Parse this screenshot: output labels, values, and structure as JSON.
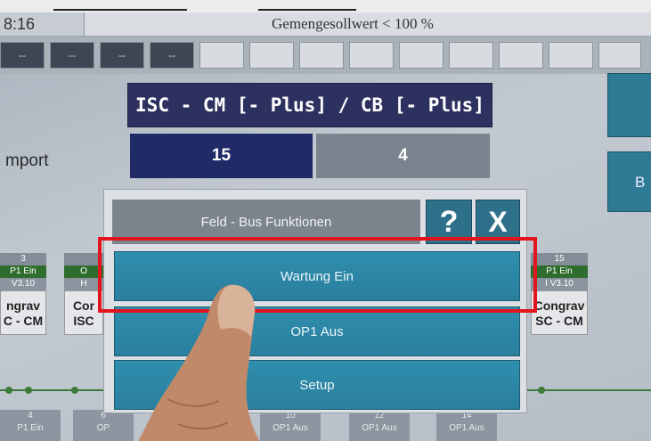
{
  "header": {
    "clock": "8:16",
    "status": "Gemengesollwert < 100 %"
  },
  "slots": [
    {
      "label": "--"
    },
    {
      "label": "--"
    },
    {
      "label": "--"
    },
    {
      "label": "--"
    }
  ],
  "panel": {
    "title": "ISC - CM [- Plus] / CB [- Plus]",
    "value_left": "15",
    "value_right": "4",
    "side_label": "mport",
    "right_button_label": "B"
  },
  "modules_left": {
    "number": "3",
    "state": "P1 Ein",
    "version": "V3.10",
    "name_line1": "ngrav",
    "name_line2": "C - CM"
  },
  "modules_left2": {
    "state": "O",
    "version": "H",
    "name_line1": "Cor",
    "name_line2": "ISC"
  },
  "modules_right": {
    "number": "15",
    "state": "P1 Ein",
    "version": "I V3.10",
    "name_line1": "Congrav",
    "name_line2": "SC - CM"
  },
  "bottom_tabs": [
    {
      "number": "4",
      "label": "P1 Ein"
    },
    {
      "number": "6",
      "label": "OP"
    },
    {
      "number": "10",
      "label": "OP1 Aus"
    },
    {
      "number": "12",
      "label": "OP1 Aus"
    },
    {
      "number": "14",
      "label": "OP1 Aus"
    }
  ],
  "dialog": {
    "title": "Feld - Bus Funktionen",
    "help_label": "?",
    "close_label": "X",
    "menu": [
      {
        "label": "Wartung Ein"
      },
      {
        "label": "OP1 Aus"
      },
      {
        "label": "Setup"
      }
    ]
  },
  "colors": {
    "accent": "#2a7f9d",
    "highlight": "#e4141c",
    "title_bg": "#2d3160"
  }
}
